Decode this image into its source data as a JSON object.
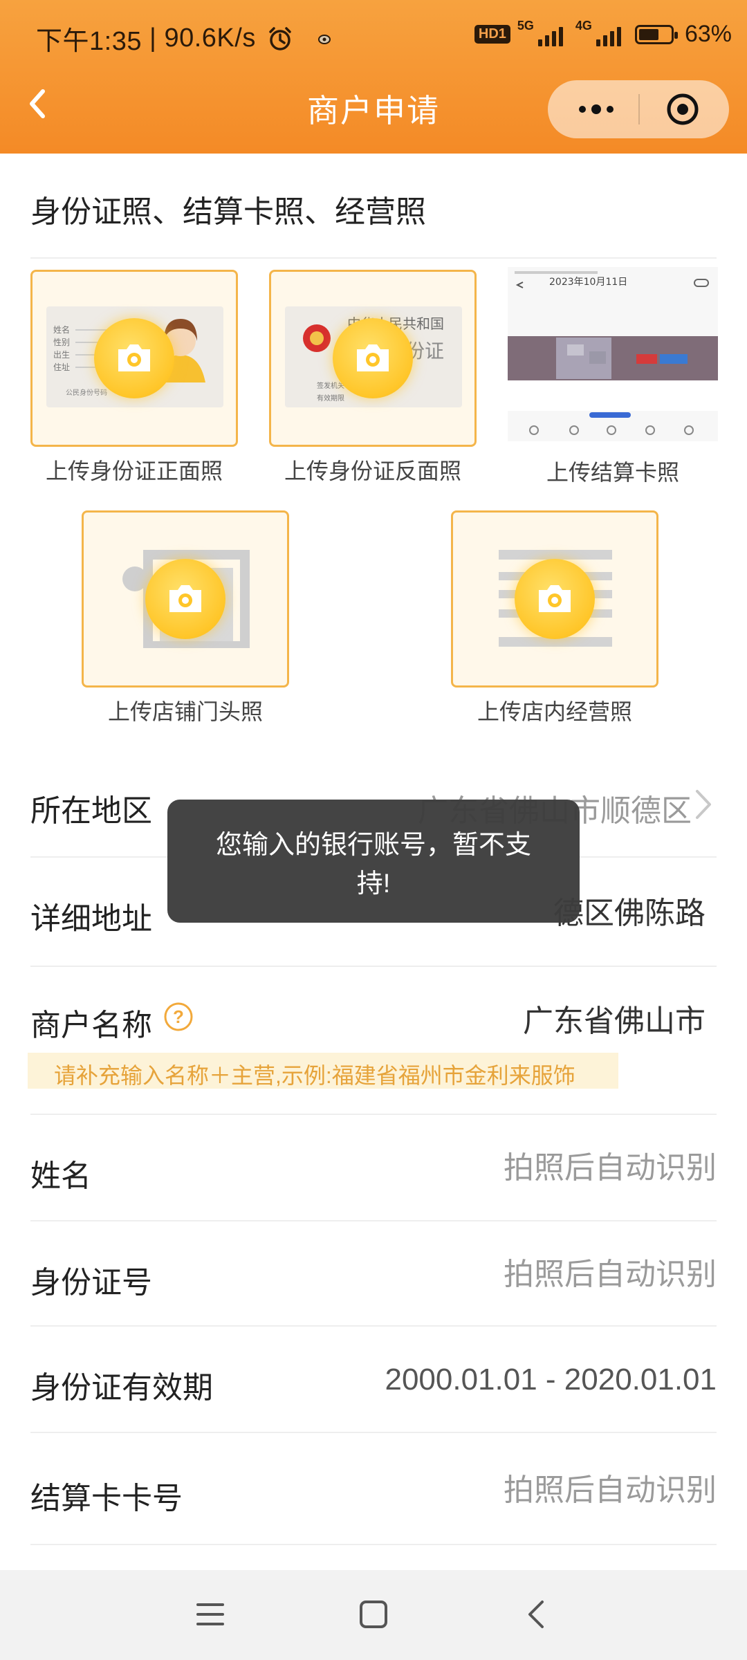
{
  "status_bar": {
    "time": "下午1:35",
    "speed": "90.6K/s",
    "hd_badge": "HD1",
    "net1": "5G",
    "net2": "4G",
    "battery": "63%",
    "battery_level": 0.63
  },
  "header": {
    "title": "商户申请"
  },
  "upload_section": {
    "title": "身份证照、结算卡照、经营照",
    "tiles": [
      {
        "label": "上传身份证正面照",
        "icon": "camera-icon"
      },
      {
        "label": "上传身份证反面照",
        "icon": "camera-icon"
      },
      {
        "label": "上传结算卡照"
      },
      {
        "label": "上传店铺门头照",
        "icon": "camera-icon"
      },
      {
        "label": "上传店内经营照",
        "icon": "camera-icon"
      }
    ],
    "id_front_sample": {
      "fields": [
        "姓名",
        "性别",
        "出生",
        "住址",
        "公民身份号码"
      ]
    },
    "id_back_sample": {
      "line1": "中华人民共和国",
      "line2": "居民身份证",
      "fields": [
        "签发机关",
        "有效期限"
      ]
    },
    "card_photo": {
      "date_text": "2023年10月11日"
    }
  },
  "form": {
    "region": {
      "label": "所在地区",
      "value": "广东省佛山市顺德区"
    },
    "address": {
      "label": "详细地址",
      "value": "德区佛陈路"
    },
    "merchant_name": {
      "label": "商户名称",
      "value": "广东省佛山市",
      "hint": "请补充输入名称＋主营,示例:福建省福州市金利来服饰"
    },
    "name": {
      "label": "姓名",
      "placeholder": "拍照后自动识别"
    },
    "id_number": {
      "label": "身份证号",
      "placeholder": "拍照后自动识别"
    },
    "id_validity": {
      "label": "身份证有效期",
      "value": "2000.01.01 - 2020.01.01"
    },
    "card_number": {
      "label": "结算卡卡号",
      "placeholder": "拍照后自动识别"
    }
  },
  "toast": {
    "message": "您输入的银行账号，暂不支持!"
  },
  "colors": {
    "header_top": "#f7a23f",
    "header_bottom": "#f48a26",
    "accent": "#f4b54a",
    "hint_text": "#e6a33a",
    "hint_bg": "#fdf3d8"
  }
}
